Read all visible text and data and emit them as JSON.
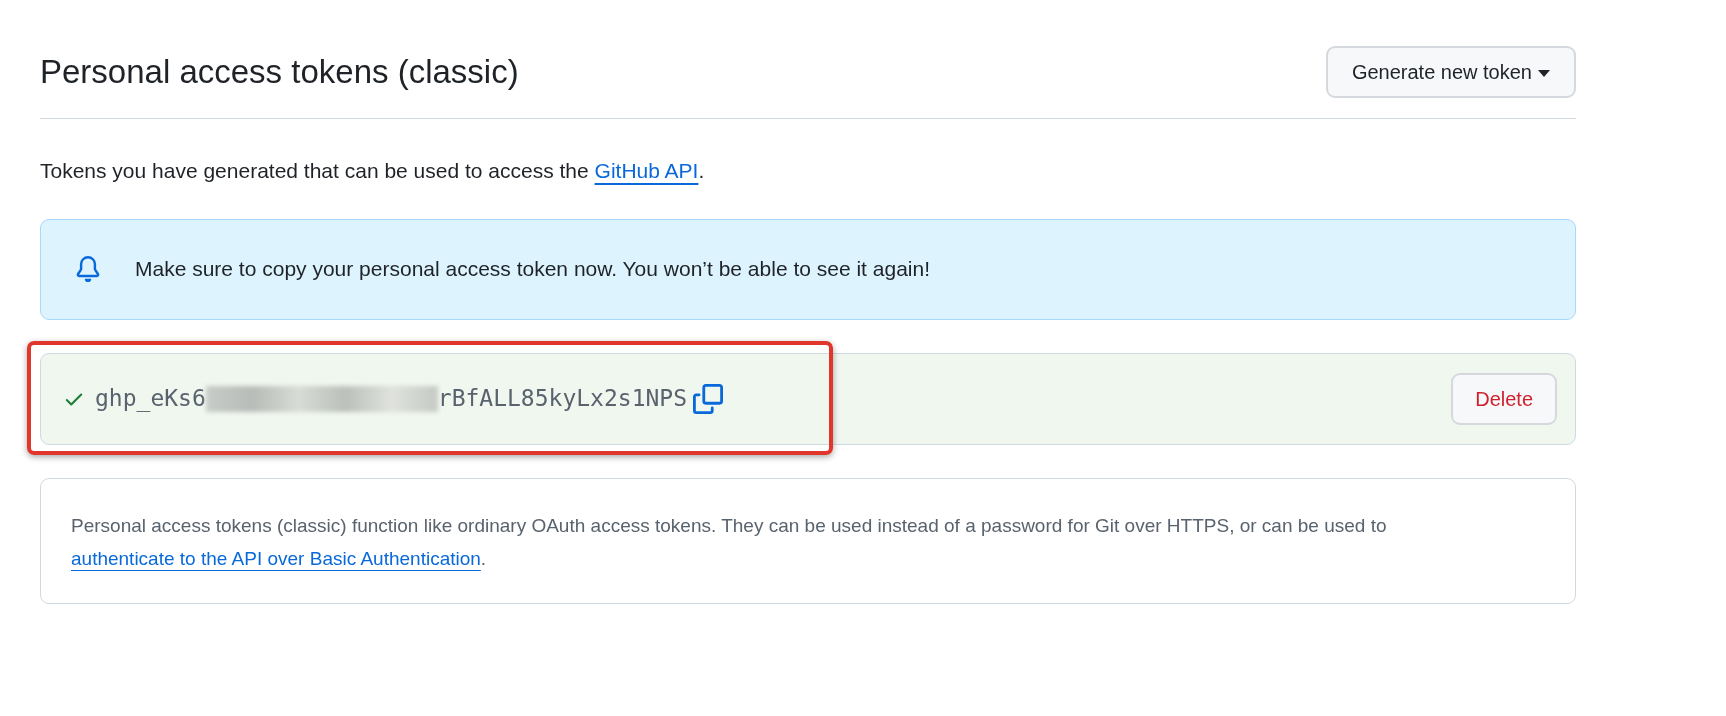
{
  "header": {
    "title": "Personal access tokens (classic)",
    "generate_button": "Generate new token"
  },
  "intro": {
    "text": "Tokens you have generated that can be used to access the ",
    "link": "GitHub API",
    "end": "."
  },
  "flash": {
    "message": "Make sure to copy your personal access token now. You won’t be able to see it again!"
  },
  "token": {
    "start": "ghp_eKs6",
    "redacted": true,
    "end": "rBfALL85kyLx2s1NPS",
    "delete_button": "Delete"
  },
  "info": {
    "text": "Personal access tokens (classic) function like ordinary OAuth access tokens. They can be used instead of a password for Git over HTTPS, or can be used to ",
    "link": "authenticate to the API over Basic Authentication",
    "end": "."
  }
}
